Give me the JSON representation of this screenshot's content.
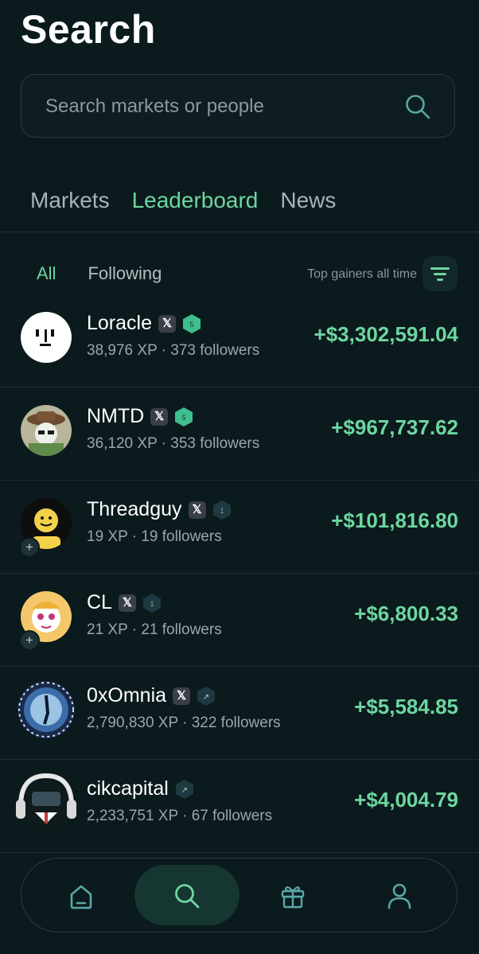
{
  "header": {
    "title": "Search"
  },
  "search": {
    "placeholder": "Search markets or people",
    "icon": "search-icon"
  },
  "tabs": [
    {
      "label": "Markets",
      "active": false
    },
    {
      "label": "Leaderboard",
      "active": true
    },
    {
      "label": "News",
      "active": false
    }
  ],
  "filters": {
    "all_label": "All",
    "following_label": "Following",
    "sort_label": "Top gainers all time",
    "sort_icon": "filter-icon"
  },
  "leaderboard": [
    {
      "name": "Loracle",
      "x_badge": "𝕏",
      "level": "5",
      "xp": "38,976 XP",
      "followers": "373 followers",
      "pnl": "+$3,302,591.04"
    },
    {
      "name": "NMTD",
      "x_badge": "𝕏",
      "level": "5",
      "xp": "36,120 XP",
      "followers": "353 followers",
      "pnl": "+$967,737.62"
    },
    {
      "name": "Threadguy",
      "x_badge": "𝕏",
      "level": "1",
      "xp": "19 XP",
      "followers": "19 followers",
      "pnl": "+$101,816.80"
    },
    {
      "name": "CL",
      "x_badge": "𝕏",
      "level": "1",
      "xp": "21 XP",
      "followers": "21 followers",
      "pnl": "+$6,800.33"
    },
    {
      "name": "0xOmnia",
      "x_badge": "𝕏",
      "level": "↗",
      "xp": "2,790,830 XP",
      "followers": "322 followers",
      "pnl": "+$5,584.85"
    },
    {
      "name": "cikcapital",
      "x_badge": "",
      "level": "↗",
      "xp": "2,233,751 XP",
      "followers": "67 followers",
      "pnl": "+$4,004.79"
    }
  ],
  "follow_plus": "+",
  "meta_separator": " · ",
  "colors": {
    "accent": "#6dd6a0",
    "background": "#0b1a1d",
    "hex_green": "#3fbf8f",
    "hex_dark": "#1e3a40"
  },
  "bottom_nav": [
    {
      "name": "home",
      "icon": "home-icon",
      "active": false
    },
    {
      "name": "search",
      "icon": "search-icon",
      "active": true
    },
    {
      "name": "rewards",
      "icon": "gift-icon",
      "active": false
    },
    {
      "name": "profile",
      "icon": "user-icon",
      "active": false
    }
  ]
}
